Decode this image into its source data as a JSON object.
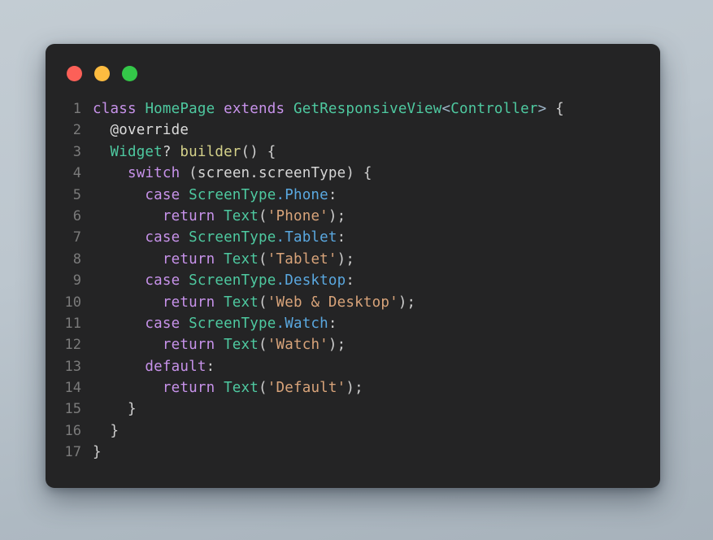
{
  "window": {
    "chrome_dots": [
      {
        "name": "close",
        "color": "#fc6058",
        "label": ""
      },
      {
        "name": "minimize",
        "color": "#fdbc40",
        "label": ""
      },
      {
        "name": "zoom",
        "color": "#34c749",
        "label": ""
      }
    ],
    "background_color": "#242425",
    "page_background": "#bcc6ce"
  },
  "editor": {
    "language": "dart",
    "line_count": 17,
    "line_numbers": [
      "1",
      "2",
      "3",
      "4",
      "5",
      "6",
      "7",
      "8",
      "9",
      "10",
      "11",
      "12",
      "13",
      "14",
      "15",
      "16",
      "17"
    ],
    "plain_text": "class HomePage extends GetResponsiveView<Controller> {\n  @override\n  Widget? builder() {\n    switch (screen.screenType) {\n      case ScreenType.Phone:\n        return Text('Phone');\n      case ScreenType.Tablet:\n        return Text('Tablet');\n      case ScreenType.Desktop:\n        return Text('Web & Desktop');\n      case ScreenType.Watch:\n        return Text('Watch');\n      default:\n        return Text('Default');\n    }\n  }\n}",
    "lines": [
      {
        "n": "1",
        "tokens": [
          {
            "t": "keyword",
            "v": "class"
          },
          {
            "t": "plain",
            "v": " "
          },
          {
            "t": "type",
            "v": "HomePage"
          },
          {
            "t": "plain",
            "v": " "
          },
          {
            "t": "keyword",
            "v": "extends"
          },
          {
            "t": "plain",
            "v": " "
          },
          {
            "t": "type",
            "v": "GetResponsiveView"
          },
          {
            "t": "angle",
            "v": "<"
          },
          {
            "t": "type",
            "v": "Controller"
          },
          {
            "t": "angle",
            "v": ">"
          },
          {
            "t": "plain",
            "v": " "
          },
          {
            "t": "punct",
            "v": "{"
          }
        ]
      },
      {
        "n": "2",
        "tokens": [
          {
            "t": "plain",
            "v": "  "
          },
          {
            "t": "anno",
            "v": "@override"
          }
        ]
      },
      {
        "n": "3",
        "tokens": [
          {
            "t": "plain",
            "v": "  "
          },
          {
            "t": "type",
            "v": "Widget"
          },
          {
            "t": "plain",
            "v": "? "
          },
          {
            "t": "func",
            "v": "builder"
          },
          {
            "t": "punct",
            "v": "() {"
          }
        ]
      },
      {
        "n": "4",
        "tokens": [
          {
            "t": "plain",
            "v": "    "
          },
          {
            "t": "keyword",
            "v": "switch"
          },
          {
            "t": "plain",
            "v": " "
          },
          {
            "t": "punct",
            "v": "("
          },
          {
            "t": "plain",
            "v": "screen.screenType"
          },
          {
            "t": "punct",
            "v": ") {"
          }
        ]
      },
      {
        "n": "5",
        "tokens": [
          {
            "t": "plain",
            "v": "      "
          },
          {
            "t": "keyword",
            "v": "case"
          },
          {
            "t": "plain",
            "v": " "
          },
          {
            "t": "type",
            "v": "ScreenType"
          },
          {
            "t": "member",
            "v": ".Phone"
          },
          {
            "t": "punct",
            "v": ":"
          }
        ]
      },
      {
        "n": "6",
        "tokens": [
          {
            "t": "plain",
            "v": "        "
          },
          {
            "t": "keyword",
            "v": "return"
          },
          {
            "t": "plain",
            "v": " "
          },
          {
            "t": "type",
            "v": "Text"
          },
          {
            "t": "punct",
            "v": "("
          },
          {
            "t": "string",
            "v": "'Phone'"
          },
          {
            "t": "punct",
            "v": ");"
          }
        ]
      },
      {
        "n": "7",
        "tokens": [
          {
            "t": "plain",
            "v": "      "
          },
          {
            "t": "keyword",
            "v": "case"
          },
          {
            "t": "plain",
            "v": " "
          },
          {
            "t": "type",
            "v": "ScreenType"
          },
          {
            "t": "member",
            "v": ".Tablet"
          },
          {
            "t": "punct",
            "v": ":"
          }
        ]
      },
      {
        "n": "8",
        "tokens": [
          {
            "t": "plain",
            "v": "        "
          },
          {
            "t": "keyword",
            "v": "return"
          },
          {
            "t": "plain",
            "v": " "
          },
          {
            "t": "type",
            "v": "Text"
          },
          {
            "t": "punct",
            "v": "("
          },
          {
            "t": "string",
            "v": "'Tablet'"
          },
          {
            "t": "punct",
            "v": ");"
          }
        ]
      },
      {
        "n": "9",
        "tokens": [
          {
            "t": "plain",
            "v": "      "
          },
          {
            "t": "keyword",
            "v": "case"
          },
          {
            "t": "plain",
            "v": " "
          },
          {
            "t": "type",
            "v": "ScreenType"
          },
          {
            "t": "member",
            "v": ".Desktop"
          },
          {
            "t": "punct",
            "v": ":"
          }
        ]
      },
      {
        "n": "10",
        "tokens": [
          {
            "t": "plain",
            "v": "        "
          },
          {
            "t": "keyword",
            "v": "return"
          },
          {
            "t": "plain",
            "v": " "
          },
          {
            "t": "type",
            "v": "Text"
          },
          {
            "t": "punct",
            "v": "("
          },
          {
            "t": "string",
            "v": "'Web & Desktop'"
          },
          {
            "t": "punct",
            "v": ");"
          }
        ]
      },
      {
        "n": "11",
        "tokens": [
          {
            "t": "plain",
            "v": "      "
          },
          {
            "t": "keyword",
            "v": "case"
          },
          {
            "t": "plain",
            "v": " "
          },
          {
            "t": "type",
            "v": "ScreenType"
          },
          {
            "t": "member",
            "v": ".Watch"
          },
          {
            "t": "punct",
            "v": ":"
          }
        ]
      },
      {
        "n": "12",
        "tokens": [
          {
            "t": "plain",
            "v": "        "
          },
          {
            "t": "keyword",
            "v": "return"
          },
          {
            "t": "plain",
            "v": " "
          },
          {
            "t": "type",
            "v": "Text"
          },
          {
            "t": "punct",
            "v": "("
          },
          {
            "t": "string",
            "v": "'Watch'"
          },
          {
            "t": "punct",
            "v": ");"
          }
        ]
      },
      {
        "n": "13",
        "tokens": [
          {
            "t": "plain",
            "v": "      "
          },
          {
            "t": "keyword",
            "v": "default"
          },
          {
            "t": "punct",
            "v": ":"
          }
        ]
      },
      {
        "n": "14",
        "tokens": [
          {
            "t": "plain",
            "v": "        "
          },
          {
            "t": "keyword",
            "v": "return"
          },
          {
            "t": "plain",
            "v": " "
          },
          {
            "t": "type",
            "v": "Text"
          },
          {
            "t": "punct",
            "v": "("
          },
          {
            "t": "string",
            "v": "'Default'"
          },
          {
            "t": "punct",
            "v": ");"
          }
        ]
      },
      {
        "n": "15",
        "tokens": [
          {
            "t": "plain",
            "v": "    "
          },
          {
            "t": "punct",
            "v": "}"
          }
        ]
      },
      {
        "n": "16",
        "tokens": [
          {
            "t": "plain",
            "v": "  "
          },
          {
            "t": "punct",
            "v": "}"
          }
        ]
      },
      {
        "n": "17",
        "tokens": [
          {
            "t": "punct",
            "v": "}"
          }
        ]
      }
    ]
  }
}
